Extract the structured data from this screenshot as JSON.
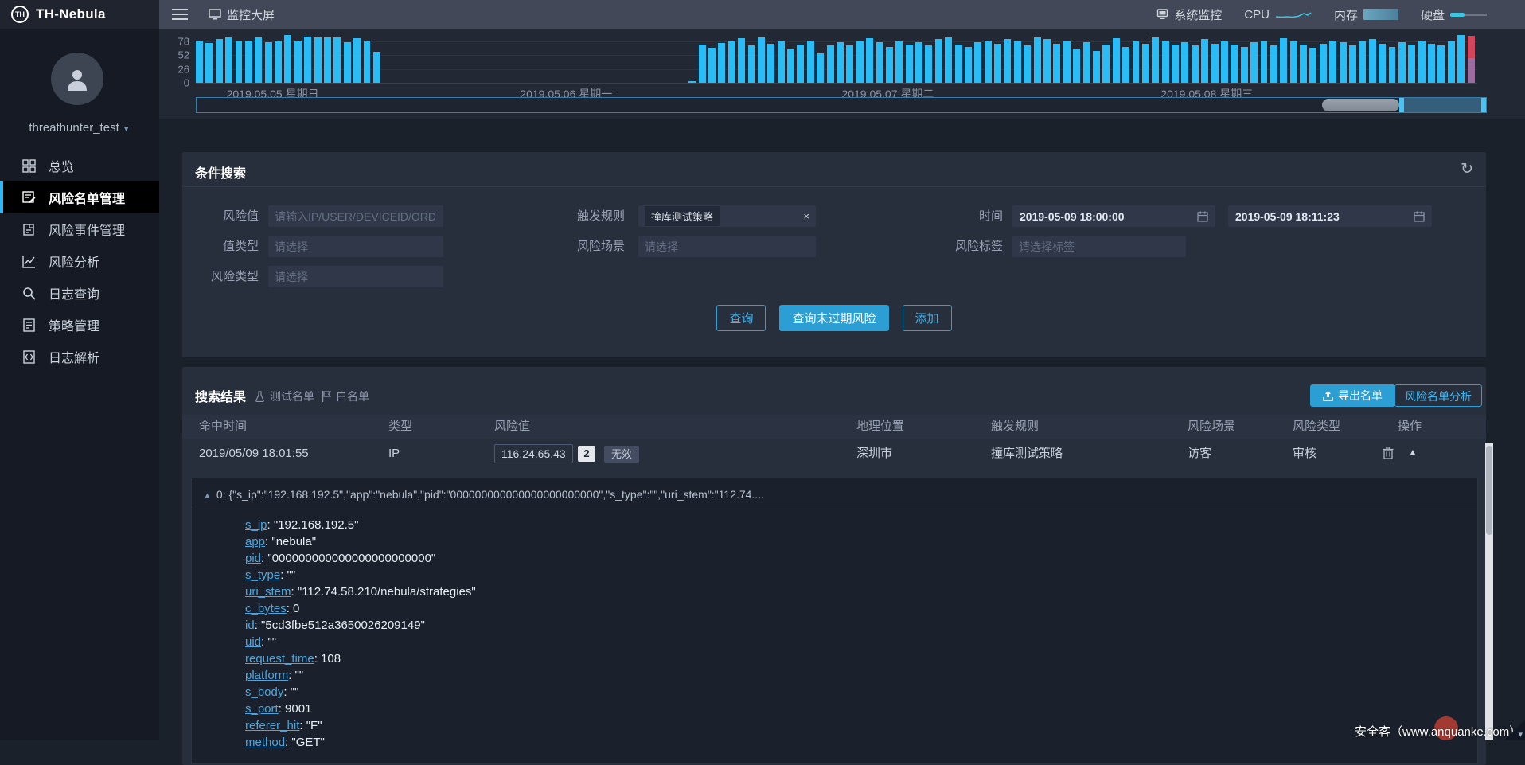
{
  "app": {
    "logo_text": "TH-Nebula",
    "logo_monogram": "TH"
  },
  "topbar": {
    "page_title": "监控大屏",
    "system_monitor_label": "系统监控",
    "cpu_label": "CPU",
    "memory_label": "内存",
    "disk_label": "硬盘"
  },
  "sidebar": {
    "username": "threathunter_test",
    "items": [
      {
        "id": "overview",
        "label": "总览",
        "active": false
      },
      {
        "id": "risk-list",
        "label": "风险名单管理",
        "active": true
      },
      {
        "id": "risk-event",
        "label": "风险事件管理",
        "active": false
      },
      {
        "id": "risk-analysis",
        "label": "风险分析",
        "active": false
      },
      {
        "id": "log-search",
        "label": "日志查询",
        "active": false
      },
      {
        "id": "strategy",
        "label": "策略管理",
        "active": false
      },
      {
        "id": "log-parse",
        "label": "日志解析",
        "active": false
      }
    ]
  },
  "chart_data": {
    "type": "bar",
    "title": "",
    "xlabel": "",
    "ylabel": "",
    "yticks": [
      78,
      52,
      26,
      0
    ],
    "ylim": [
      0,
      104
    ],
    "grid": true,
    "bar_color": "#29bdf8",
    "total_slots": 130,
    "x_axis_labels": [
      {
        "text": "2019.05.05 星期日",
        "pct": 6.0
      },
      {
        "text": "2019.05.06 星期一",
        "pct": 28.9
      },
      {
        "text": "2019.05.07 星期二",
        "pct": 54.0
      },
      {
        "text": "2019.05.08 星期三",
        "pct": 78.9
      }
    ],
    "segments": [
      {
        "start_slot": 0,
        "values": [
          80,
          75,
          82,
          86,
          78,
          79,
          86,
          77,
          80,
          90,
          79,
          87,
          86,
          85,
          86,
          76,
          84,
          79,
          58
        ]
      },
      {
        "start_slot": 50,
        "values": [
          3
        ]
      },
      {
        "start_slot": 51,
        "values": [
          72,
          66,
          75,
          80,
          84,
          70,
          86,
          74,
          78,
          63,
          72,
          80,
          56,
          70,
          76,
          70,
          78,
          84,
          76,
          68,
          80,
          72,
          76,
          70,
          82,
          86,
          72,
          68,
          76,
          80,
          74,
          82,
          78,
          70,
          86,
          82,
          74,
          80,
          64,
          76,
          60,
          72,
          84,
          68,
          78,
          74,
          86,
          80,
          72,
          76,
          70,
          82,
          74,
          78,
          72,
          68,
          76,
          80,
          70,
          84,
          78,
          72,
          66,
          74,
          80,
          76,
          70,
          78,
          82,
          74,
          68,
          76,
          72,
          80,
          74,
          70,
          78,
          90
        ]
      }
    ],
    "stacked_bar": {
      "slot": 129,
      "bottom_value": 46,
      "bottom_color": "#9b6d9e",
      "top_value": 42,
      "top_color": "#d2455a"
    },
    "datazoom": {
      "thumb_pct": [
        87.3,
        93.3
      ],
      "selection_pct": [
        93.3,
        100
      ]
    }
  },
  "search_panel": {
    "title": "条件搜索",
    "fields": {
      "risk_value": {
        "label": "风险值",
        "placeholder": "请输入IP/USER/DEVICEID/ORDERID"
      },
      "trigger_rule": {
        "label": "触发规则",
        "tag": "撞库测试策略",
        "remove_label": "×"
      },
      "time": {
        "label": "时间",
        "start": "2019-05-09 18:00:00",
        "end": "2019-05-09 18:11:23"
      },
      "value_type": {
        "label": "值类型",
        "placeholder": "请选择"
      },
      "risk_scene": {
        "label": "风险场景",
        "placeholder": "请选择"
      },
      "risk_tag": {
        "label": "风险标签",
        "placeholder": "请选择标签"
      },
      "risk_type": {
        "label": "风险类型",
        "placeholder": "请选择"
      }
    },
    "buttons": {
      "query": "查询",
      "query_unexpired": "查询未过期风险",
      "add": "添加"
    }
  },
  "results": {
    "title": "搜索结果",
    "test_list_label": "测试名单",
    "white_list_label": "白名单",
    "export_label": "导出名单",
    "analyze_label": "风险名单分析",
    "table": {
      "columns": [
        "命中时间",
        "类型",
        "风险值",
        "地理位置",
        "触发规则",
        "风险场景",
        "风险类型",
        "操作"
      ],
      "row": {
        "hit_time": "2019/05/09 18:01:55",
        "type": "IP",
        "risk_value": "116.24.65.43",
        "count": "2",
        "status": "无效",
        "geo": "深圳市",
        "rule": "撞库测试策略",
        "scene": "访客",
        "risk_type": "审核"
      }
    },
    "detail": {
      "summary": "0: {\"s_ip\":\"192.168.192.5\",\"app\":\"nebula\",\"pid\":\"000000000000000000000000\",\"s_type\":\"\",\"uri_stem\":\"112.74....",
      "entries": [
        {
          "key": "s_ip",
          "value": "\"192.168.192.5\""
        },
        {
          "key": "app",
          "value": "\"nebula\""
        },
        {
          "key": "pid",
          "value": "\"000000000000000000000000\""
        },
        {
          "key": "s_type",
          "value": "\"\""
        },
        {
          "key": "uri_stem",
          "value": "\"112.74.58.210/nebula/strategies\""
        },
        {
          "key": "c_bytes",
          "value": "0"
        },
        {
          "key": "id",
          "value": "\"5cd3fbe512a3650026209149\""
        },
        {
          "key": "uid",
          "value": "\"\""
        },
        {
          "key": "request_time",
          "value": "108"
        },
        {
          "key": "platform",
          "value": "\"\""
        },
        {
          "key": "s_body",
          "value": "\"\""
        },
        {
          "key": "s_port",
          "value": "9001"
        },
        {
          "key": "referer_hit",
          "value": "\"F\""
        },
        {
          "key": "method",
          "value": "\"GET\""
        }
      ]
    }
  },
  "watermark": "安全客（www.anquanke.com）",
  "colors": {
    "accent": "#2db7f5",
    "bar": "#29bdf8",
    "stacked_top": "#d2455a",
    "stacked_bottom": "#9b6d9e",
    "panel": "#272e3c",
    "topbar": "#424857",
    "sidebar": "#151a24"
  }
}
